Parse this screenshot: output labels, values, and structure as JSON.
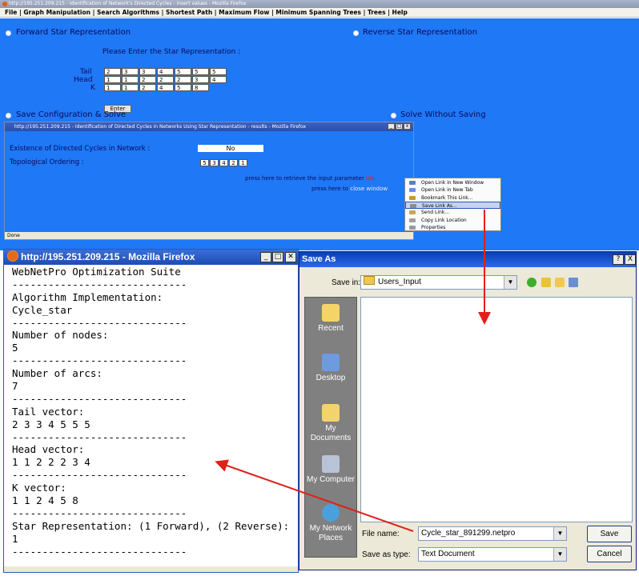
{
  "main_window": {
    "title": "http://195.251.209.215 - Identification of Network's Directed Cycles - insert values - Mozilla Firefox",
    "menu": [
      "File",
      "Graph Manipulation",
      "Search Algorithms",
      "Shortest Path",
      "Maximum Flow",
      "Minimum Spanning Trees",
      "Trees",
      "Help"
    ],
    "forward_label": "Forward Star Representation",
    "reverse_label": "Reverse Star Representation",
    "prompt": "Please Enter the Star Representation :",
    "rows": [
      {
        "label": "Tail",
        "values": [
          "2",
          "3",
          "3",
          "4",
          "5",
          "5",
          "5"
        ]
      },
      {
        "label": "Head",
        "values": [
          "1",
          "1",
          "2",
          "2",
          "2",
          "3",
          "4"
        ]
      },
      {
        "label": "K",
        "values": [
          "1",
          "1",
          "2",
          "4",
          "5",
          "8"
        ]
      }
    ],
    "enter_button": "Enter",
    "save_solve_label": "Save Configuration & Solve",
    "solve_without_label": "Solve Without Saving"
  },
  "results_window": {
    "title": "http://195.251.209.215 - Identification of Directed Cycles in Networks Using Star Representation - results - Mozilla Firefox",
    "existence_label": "Existence of Directed Cycles in Network :",
    "existence_value": "No",
    "topo_label": "Topological Ordering :",
    "topo_values": [
      "5",
      "3",
      "4",
      "2",
      "1"
    ],
    "retrieve_text": "press here to retrieve the input parameter",
    "retrieve_link": "file",
    "close_text": "press here to",
    "close_link": "close window",
    "status": "Done"
  },
  "context_menu": {
    "items": [
      {
        "label": "Open Link in New Window",
        "icon": "window-icon",
        "color": "#5b7fc9"
      },
      {
        "label": "Open Link in New Tab",
        "icon": "tab-icon",
        "color": "#6b8fd9"
      },
      {
        "label": "Bookmark This Link...",
        "icon": "bookmark-icon",
        "color": "#c59b2b"
      },
      {
        "label": "Save Link As...",
        "icon": "save-icon",
        "color": "#8d8d8d"
      },
      {
        "label": "Send Link...",
        "icon": "send-icon",
        "color": "#c8a84b"
      },
      {
        "label": "Copy Link Location",
        "icon": "copy-icon",
        "color": "#a0a0a0"
      },
      {
        "label": "Properties",
        "icon": "properties-icon",
        "color": "#9a9a9a"
      }
    ],
    "selected_index": 3
  },
  "text_window": {
    "title": "http://195.251.209.215 - Mozilla Firefox",
    "lines": [
      "WebNetPro Optimization Suite",
      "-----------------------------",
      "Algorithm Implementation:",
      "Cycle_star",
      "-----------------------------",
      "Number of nodes:",
      "5",
      "-----------------------------",
      "Number of arcs:",
      "7",
      "-----------------------------",
      "Tail vector:",
      "2 3 3 4 5 5 5",
      "-----------------------------",
      "Head vector:",
      "1 1 2 2 2 3 4",
      "-----------------------------",
      "K vector:",
      "1 1 2 4 5 8",
      "-----------------------------",
      "Star Representation: (1 Forward), (2 Reverse):",
      "1",
      "-----------------------------"
    ]
  },
  "save_dialog": {
    "title": "Save As",
    "help": "?",
    "close": "X",
    "save_in_label": "Save in:",
    "save_in_value": "Users_Input",
    "places": [
      "Recent",
      "Desktop",
      "My Documents",
      "My Computer",
      "My Network Places"
    ],
    "file_name_label": "File name:",
    "file_name_value": "Cycle_star_891299.netpro",
    "save_type_label": "Save as type:",
    "save_type_value": "Text Document",
    "save_button": "Save",
    "cancel_button": "Cancel"
  },
  "colors": {
    "page_blue": "#1f78f5",
    "arrow_red": "#e0201b",
    "title_blue": "#1d4cb2"
  }
}
